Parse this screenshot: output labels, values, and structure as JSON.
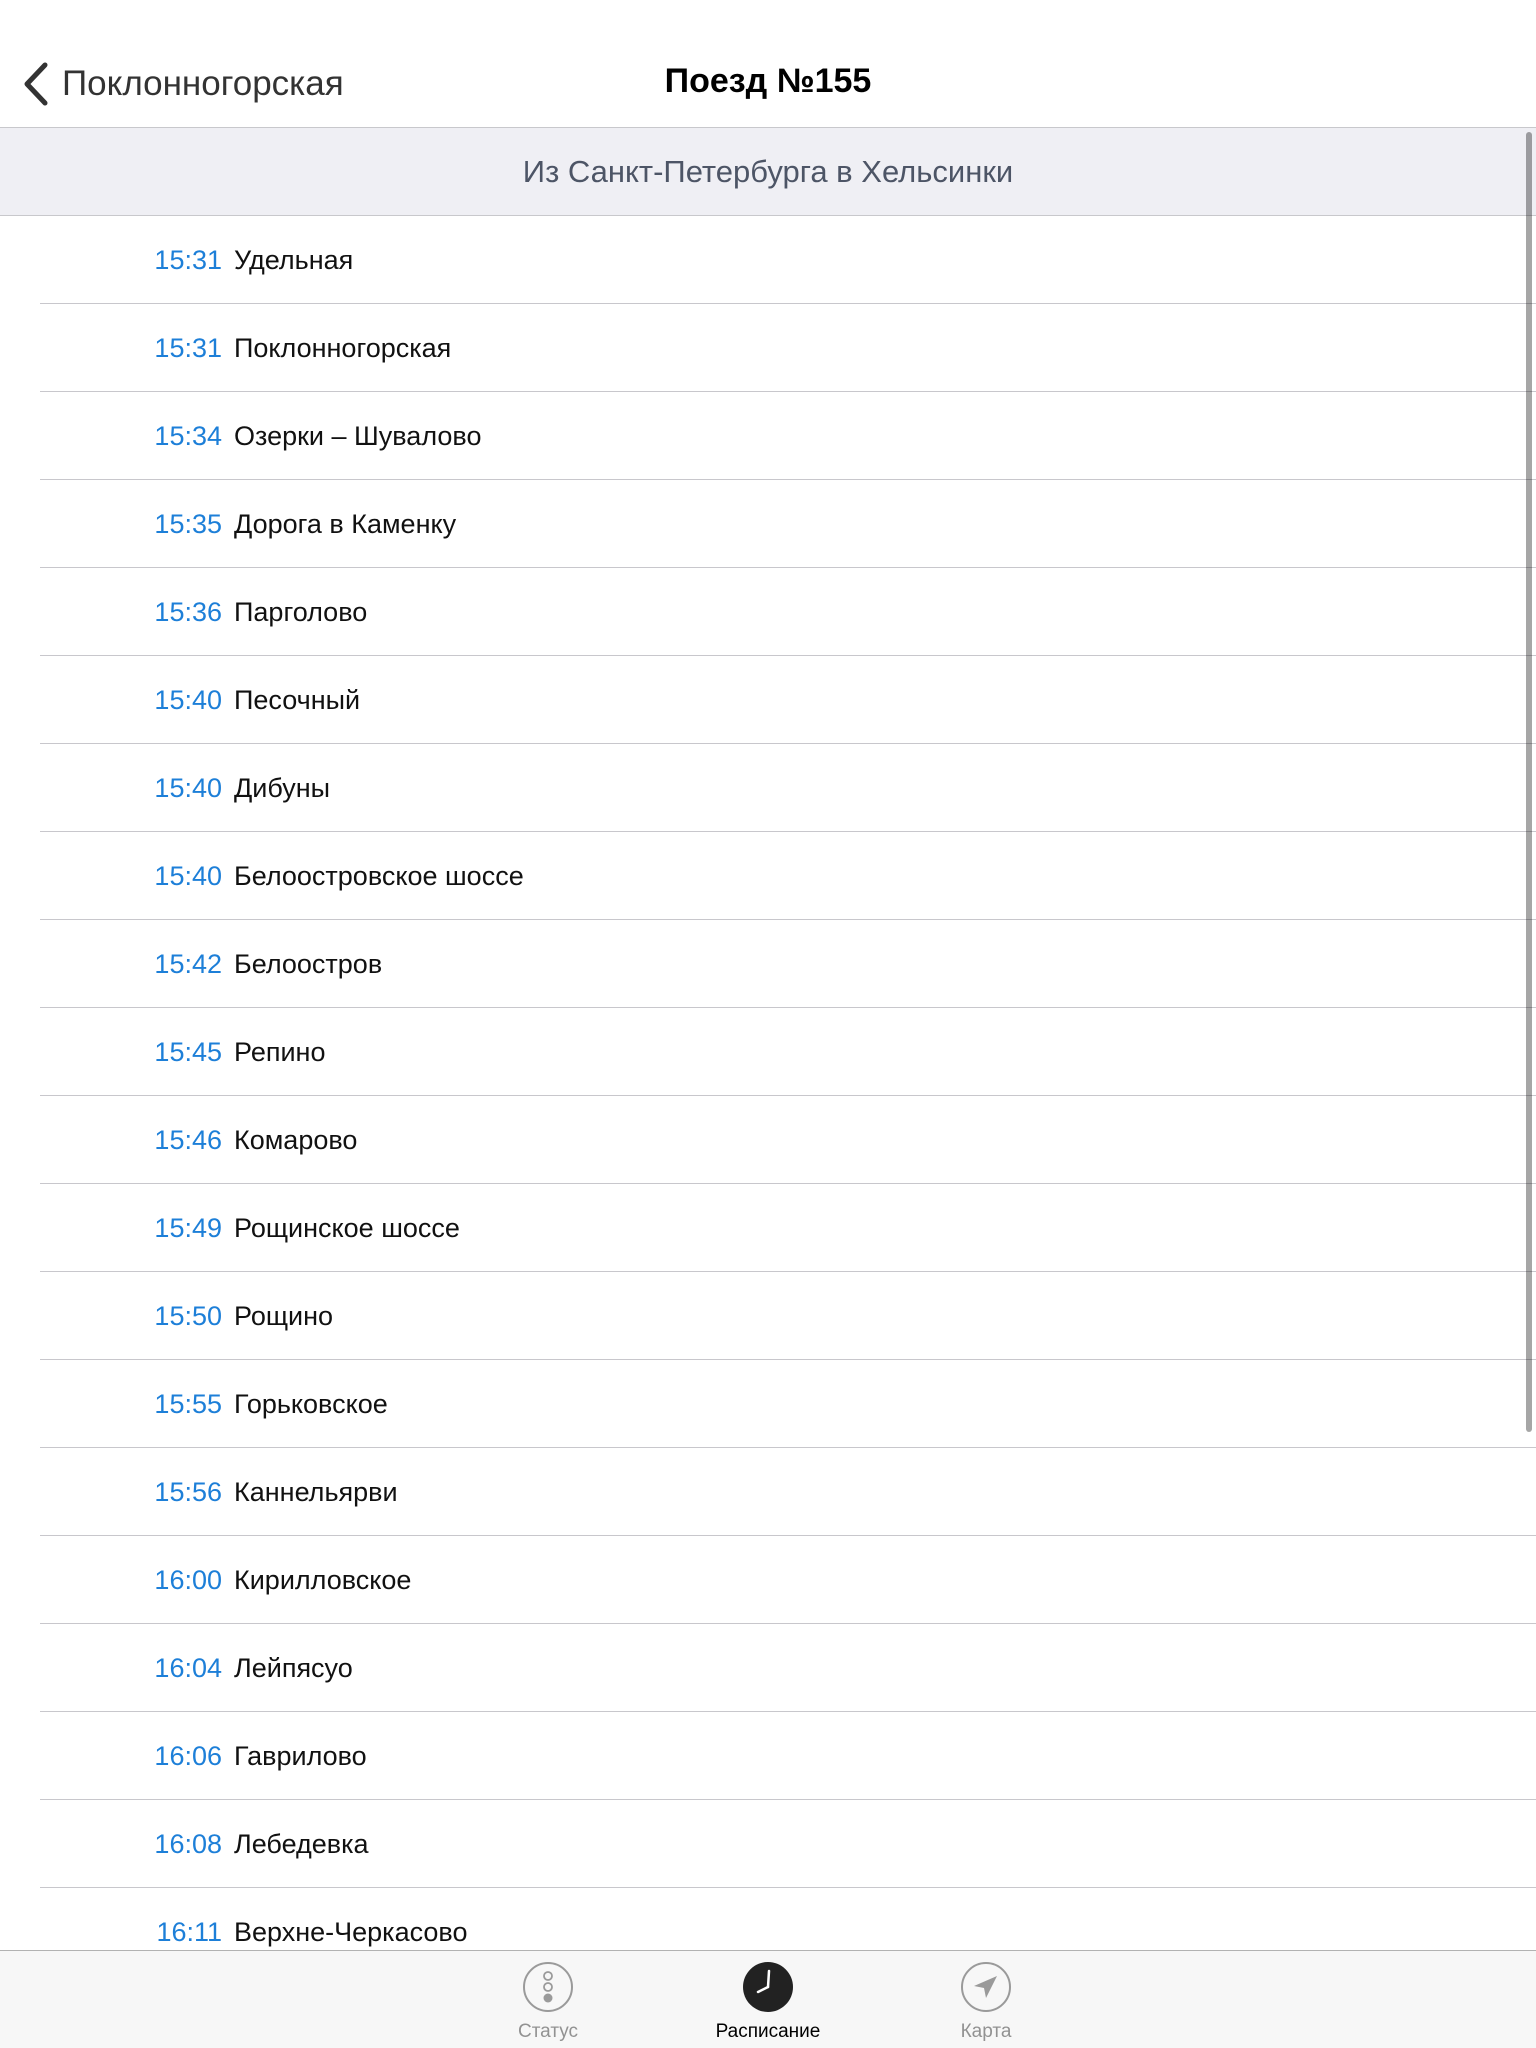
{
  "navbar": {
    "back_label": "Поклонногорская",
    "title": "Поезд №155"
  },
  "section": {
    "header": "Из Санкт-Петербурга в Хельсинки"
  },
  "stops": [
    {
      "time": "15:31",
      "name": "Удельная"
    },
    {
      "time": "15:31",
      "name": "Поклонногорская"
    },
    {
      "time": "15:34",
      "name": "Озерки – Шувалово"
    },
    {
      "time": "15:35",
      "name": "Дорога в Каменку"
    },
    {
      "time": "15:36",
      "name": "Парголово"
    },
    {
      "time": "15:40",
      "name": "Песочный"
    },
    {
      "time": "15:40",
      "name": "Дибуны"
    },
    {
      "time": "15:40",
      "name": "Белоостровское шоссе"
    },
    {
      "time": "15:42",
      "name": "Белоостров"
    },
    {
      "time": "15:45",
      "name": "Репино"
    },
    {
      "time": "15:46",
      "name": "Комарово"
    },
    {
      "time": "15:49",
      "name": "Рощинское шоссе"
    },
    {
      "time": "15:50",
      "name": "Рощино"
    },
    {
      "time": "15:55",
      "name": "Горьковское"
    },
    {
      "time": "15:56",
      "name": "Каннельярви"
    },
    {
      "time": "16:00",
      "name": "Кирилловское"
    },
    {
      "time": "16:04",
      "name": "Лейпясуо"
    },
    {
      "time": "16:06",
      "name": "Гаврилово"
    },
    {
      "time": "16:08",
      "name": "Лебедевка"
    },
    {
      "time": "16:11",
      "name": "Верхне-Черкасово"
    }
  ],
  "tabbar": {
    "tabs": [
      {
        "label": "Статус",
        "icon": "traffic-light-icon",
        "active": false
      },
      {
        "label": "Расписание",
        "icon": "clock-icon",
        "active": true
      },
      {
        "label": "Карта",
        "icon": "location-arrow-icon",
        "active": false
      }
    ]
  },
  "colors": {
    "accent": "#1d7fd8",
    "section_bg": "#efeff4",
    "tab_inactive": "#929292"
  }
}
